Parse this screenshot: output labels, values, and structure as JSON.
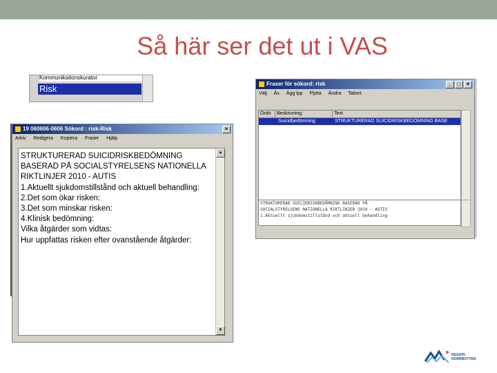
{
  "slide": {
    "title": "Så här ser det ut i VAS"
  },
  "strip": {
    "top_text": "Kommunikationskurator",
    "selected": "Risk"
  },
  "left_window": {
    "title": "19 060606-0606 Sökord : risk-Risk",
    "menu": [
      "Arkiv",
      "Redigera",
      "Kopiera",
      "Fraser",
      "Hjälp"
    ],
    "lines": [
      "STRUKTURERAD SUICIDRISKBEDÖMNING",
      "BASERAD PÅ SOCIALSTYRELSENS NATIONELLA",
      "RIKTLINJER 2010 - AUTIS",
      "1.Aktuellt sjukdomstillstånd och aktuell behandling:",
      "2.Det som ökar risken:",
      "3.Det som minskar risken:",
      "4.Klinisk bedömning:",
      "Vilka åtgärder som vidtas:",
      "Hur uppfattas risken efter ovanstående åtgärder:"
    ]
  },
  "right_window": {
    "title": "Fraser för sökord: risk",
    "menu": [
      "Välj",
      "Ås",
      "Ägg lpp",
      "Flytta",
      "Ändra",
      "Tabort"
    ],
    "columns": [
      "Ordn",
      "Beskrivning",
      "Text"
    ],
    "row": {
      "ordn": "",
      "beskrivning": "Suicidbedömning",
      "text": "STRUKTURERAD SUICIDRISKBEDÖMNING BASE"
    },
    "preview": [
      "STRUKTURERAD SUICIDRISKBEDÖMNING BASERAD PÅ",
      "SOCIALSTYRELSENS NATIONELLA RIKTLINJER 2010 - AUTIS",
      "1.Aktuellt sjukdomstillstånd och aktuell behandling"
    ]
  },
  "logo": {
    "line1": "REGION",
    "line2": "NORRBOTTEN"
  },
  "colors": {
    "title": "#c0504d",
    "topbar": "#9aa59a",
    "selection": "#1d2fa8",
    "window": "#d4d0c8"
  }
}
